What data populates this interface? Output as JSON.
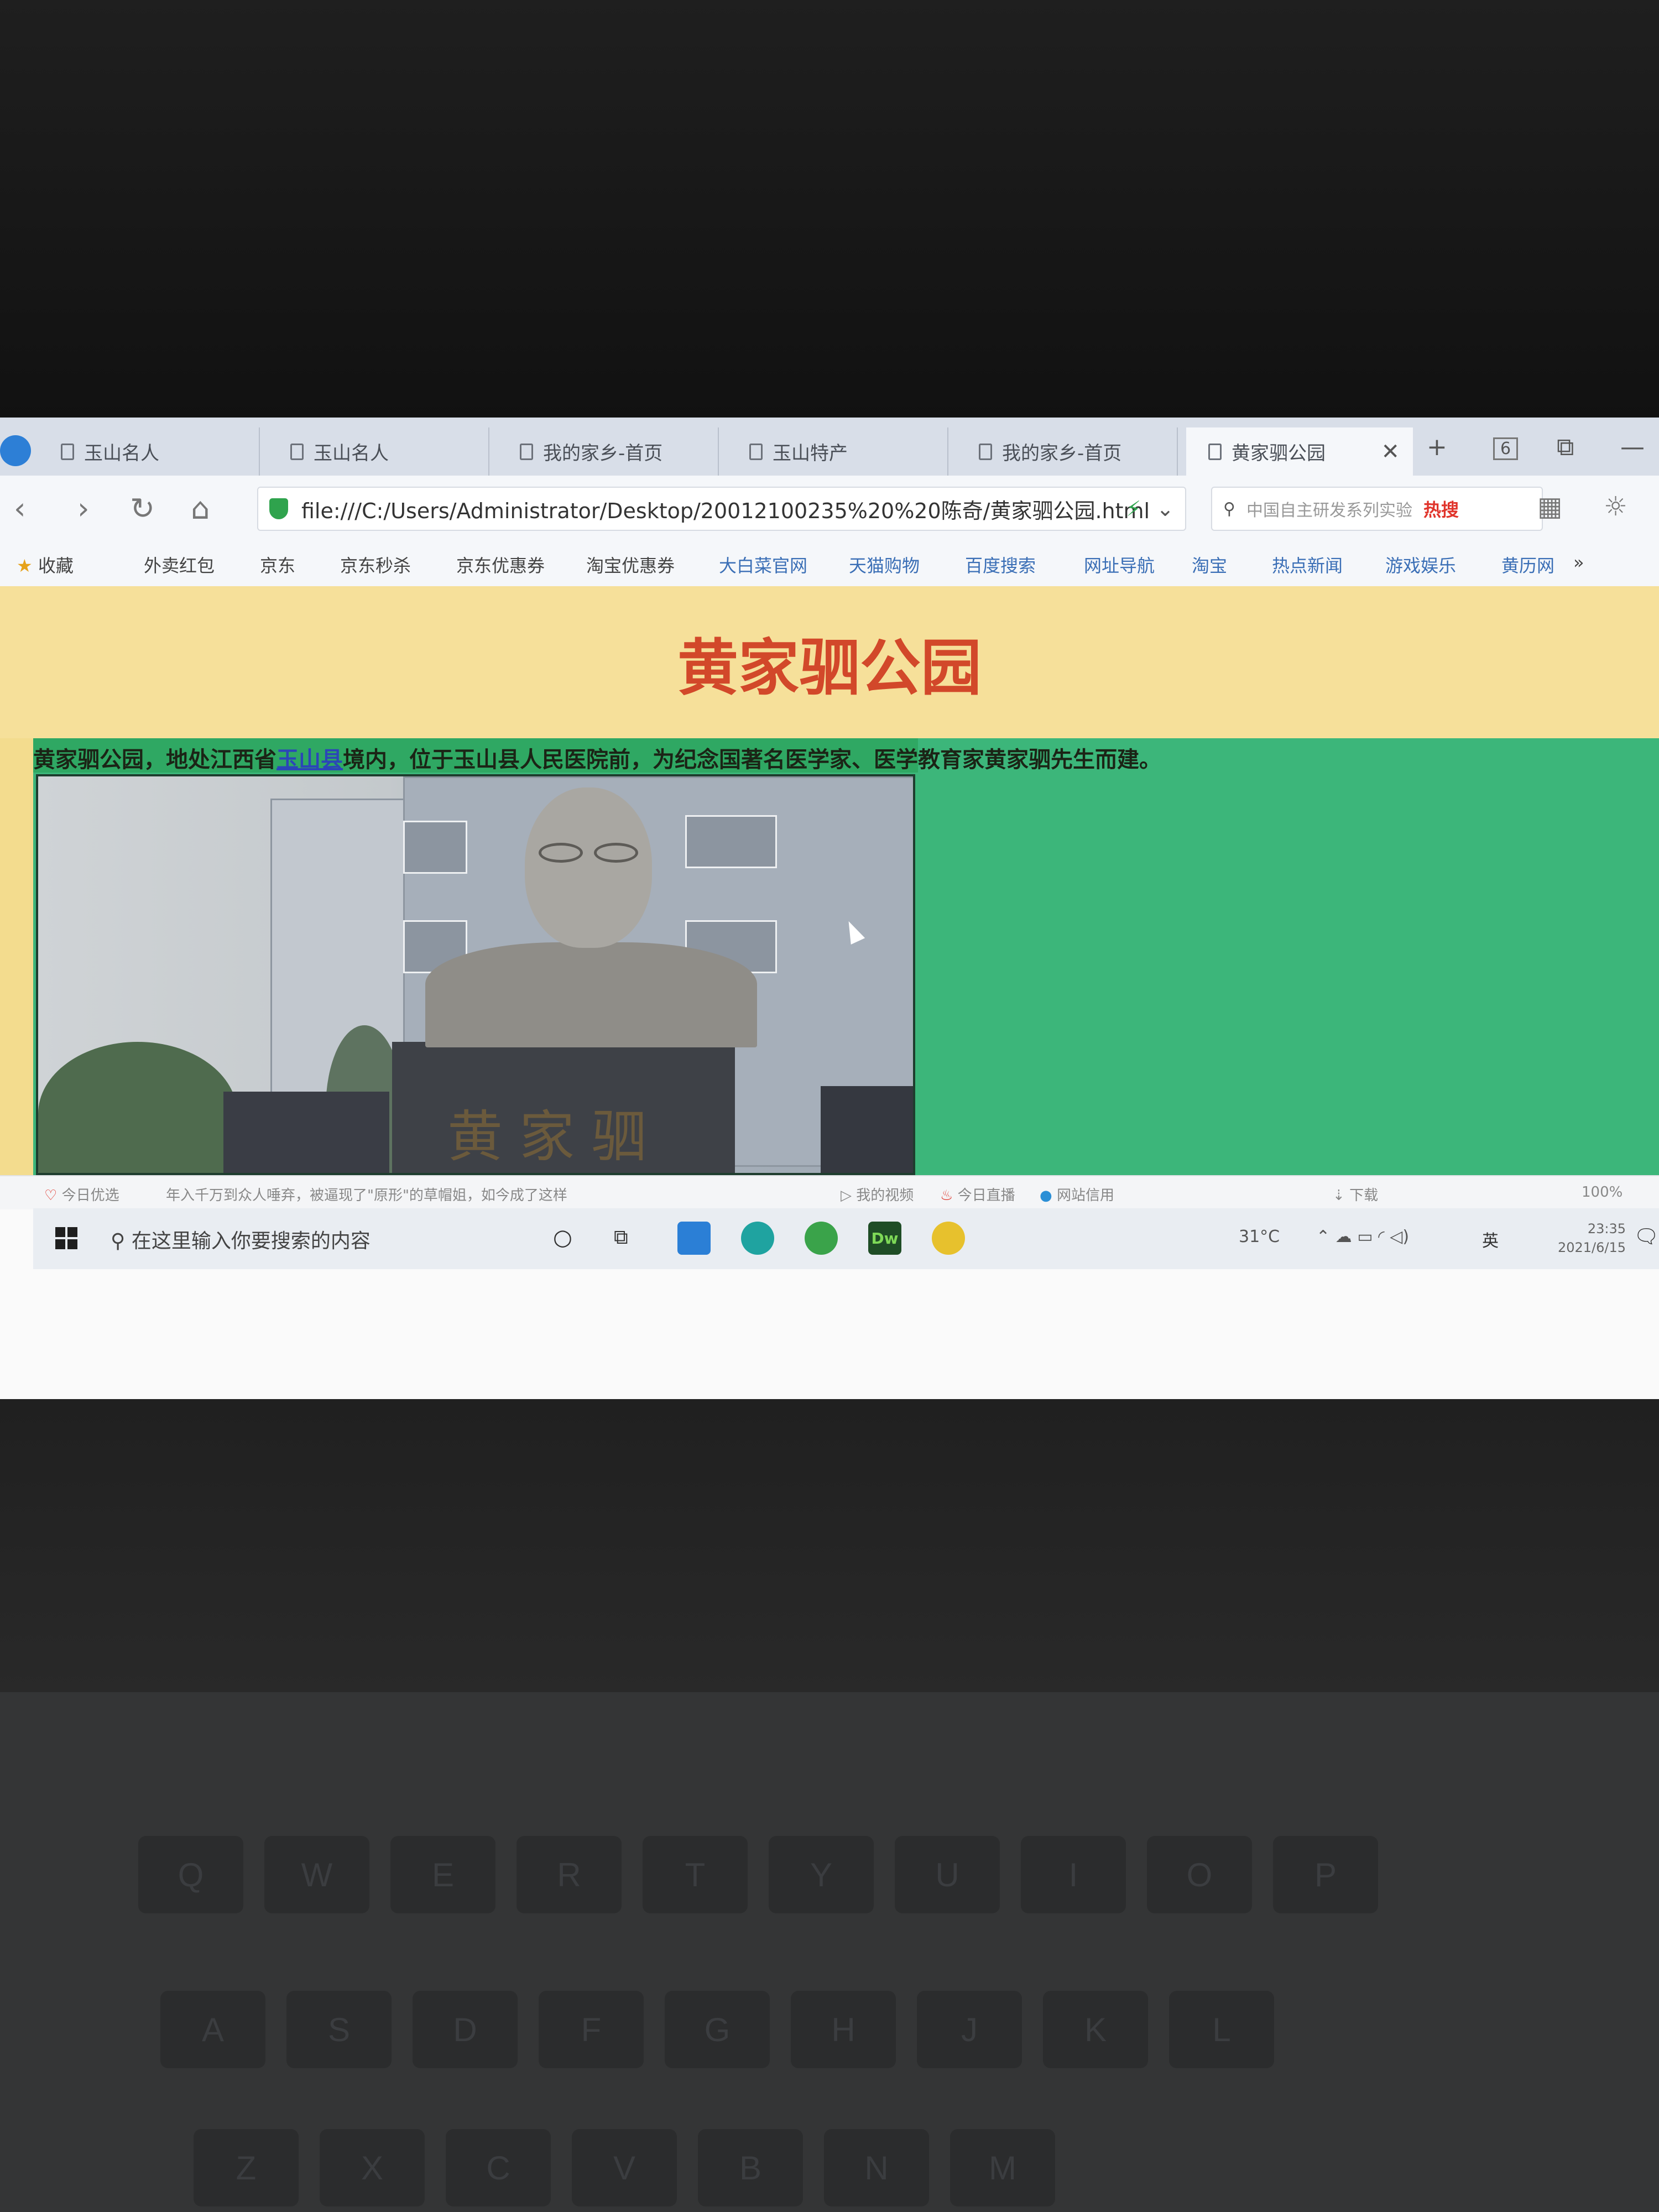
{
  "browser": {
    "tabs": [
      {
        "label": "玉山名人"
      },
      {
        "label": "玉山名人"
      },
      {
        "label": "我的家乡-首页"
      },
      {
        "label": "玉山特产"
      },
      {
        "label": "我的家乡-首页"
      },
      {
        "label": "黄家驷公园",
        "active": true
      }
    ],
    "tab_count": "6",
    "address": "file:///C:/Users/Administrator/Desktop/20012100235%20%20陈奇/黄家驷公园.html",
    "search_placeholder": "中国自主研发系列实验",
    "search_hot": "热搜",
    "bookmarks": [
      "收藏",
      "外卖红包",
      "京东",
      "京东秒杀",
      "京东优惠券",
      "淘宝优惠券",
      "大白菜官网",
      "天猫购物",
      "百度搜索",
      "网址导航",
      "淘宝",
      "热点新闻",
      "游戏娱乐",
      "黄历网"
    ],
    "bookmarks_more": "»"
  },
  "page": {
    "heading": "黄家驷公园",
    "intro_before_link": "黄家驷公园，地处江西省",
    "intro_link": "玉山县",
    "intro_after_link": "境内，位于玉山县人民医院前，为纪念国著名医学家、医学教育家黄家驷先生而建。",
    "photo_plaque": "黄家驷"
  },
  "statusbar": {
    "left_label": "今日优选",
    "news": "年入千万到众人唾弃，被逼现了\"原形\"的草帽姐，如今成了这样",
    "items": [
      "我的视频",
      "今日直播",
      "网站信用",
      "下载",
      "100%"
    ]
  },
  "taskbar": {
    "search_placeholder": "在这里输入你要搜索的内容",
    "temperature": "31°C",
    "ime": "英",
    "time": "23:35",
    "date": "2021/6/15",
    "dw_label": "Dw"
  },
  "keyboard": {
    "row1": [
      "Q",
      "W",
      "E",
      "R",
      "T",
      "Y",
      "U",
      "I",
      "O",
      "P"
    ],
    "row2": [
      "A",
      "S",
      "D",
      "F",
      "G",
      "H",
      "J",
      "K",
      "L"
    ],
    "row3": [
      "Z",
      "X",
      "C",
      "V",
      "B",
      "N",
      "M"
    ]
  },
  "colors": {
    "banner_bg": "#f6e09a",
    "heading": "#d2482a",
    "content_bg": "#3cb67a",
    "link": "#2b46b8"
  }
}
